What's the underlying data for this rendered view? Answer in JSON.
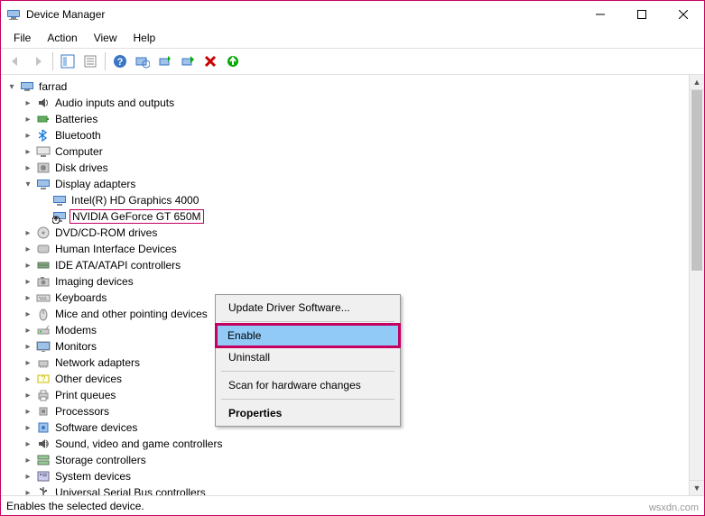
{
  "title": "Device Manager",
  "menubar": [
    "File",
    "Action",
    "View",
    "Help"
  ],
  "root": "farrad",
  "tree": [
    {
      "label": "Audio inputs and outputs",
      "expanded": false,
      "icon": "audio"
    },
    {
      "label": "Batteries",
      "expanded": false,
      "icon": "battery"
    },
    {
      "label": "Bluetooth",
      "expanded": false,
      "icon": "bluetooth"
    },
    {
      "label": "Computer",
      "expanded": false,
      "icon": "computer"
    },
    {
      "label": "Disk drives",
      "expanded": false,
      "icon": "disk"
    },
    {
      "label": "Display adapters",
      "expanded": true,
      "icon": "display",
      "children": [
        {
          "label": "Intel(R) HD Graphics 4000",
          "icon": "display"
        },
        {
          "label": "NVIDIA GeForce GT 650M",
          "icon": "display-disabled",
          "selected": true
        }
      ]
    },
    {
      "label": "DVD/CD-ROM drives",
      "expanded": false,
      "icon": "cd"
    },
    {
      "label": "Human Interface Devices",
      "expanded": false,
      "icon": "hid"
    },
    {
      "label": "IDE ATA/ATAPI controllers",
      "expanded": false,
      "icon": "ide"
    },
    {
      "label": "Imaging devices",
      "expanded": false,
      "icon": "imaging"
    },
    {
      "label": "Keyboards",
      "expanded": false,
      "icon": "keyboard"
    },
    {
      "label": "Mice and other pointing devices",
      "expanded": false,
      "icon": "mouse",
      "truncated": "Mice and other pointing device"
    },
    {
      "label": "Modems",
      "expanded": false,
      "icon": "modem"
    },
    {
      "label": "Monitors",
      "expanded": false,
      "icon": "monitor"
    },
    {
      "label": "Network adapters",
      "expanded": false,
      "icon": "network"
    },
    {
      "label": "Other devices",
      "expanded": false,
      "icon": "other"
    },
    {
      "label": "Print queues",
      "expanded": false,
      "icon": "print"
    },
    {
      "label": "Processors",
      "expanded": false,
      "icon": "cpu"
    },
    {
      "label": "Software devices",
      "expanded": false,
      "icon": "software"
    },
    {
      "label": "Sound, video and game controllers",
      "expanded": false,
      "icon": "sound"
    },
    {
      "label": "Storage controllers",
      "expanded": false,
      "icon": "storage"
    },
    {
      "label": "System devices",
      "expanded": false,
      "icon": "system"
    },
    {
      "label": "Universal Serial Bus controllers",
      "expanded": false,
      "icon": "usb",
      "truncated": "Universal Serial Bus controllers"
    }
  ],
  "context_menu": [
    {
      "label": "Update Driver Software...",
      "type": "item"
    },
    {
      "type": "sep"
    },
    {
      "label": "Enable",
      "type": "item",
      "highlighted": true
    },
    {
      "label": "Uninstall",
      "type": "item"
    },
    {
      "type": "sep"
    },
    {
      "label": "Scan for hardware changes",
      "type": "item"
    },
    {
      "type": "sep"
    },
    {
      "label": "Properties",
      "type": "item",
      "bold": true
    }
  ],
  "statusbar": "Enables the selected device.",
  "watermark": "wsxdn.com"
}
